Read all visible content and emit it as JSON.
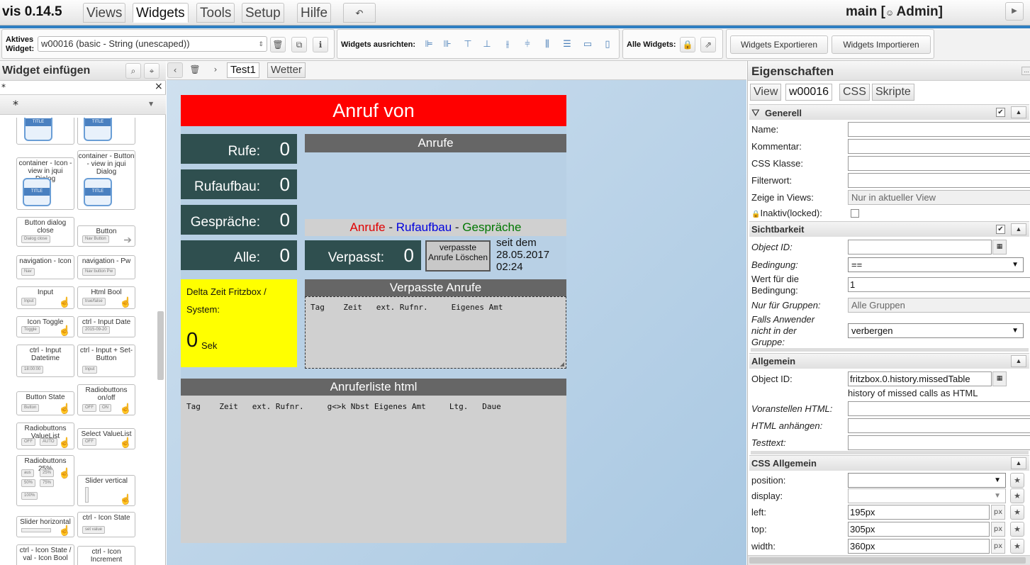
{
  "app": {
    "title": "vis 0.14.5",
    "user_label": "main [",
    "user_name": "Admin]"
  },
  "menu": {
    "items": [
      "Views",
      "Widgets",
      "Tools",
      "Setup",
      "Hilfe"
    ],
    "active": "Widgets"
  },
  "toolbar": {
    "active_widget_label_1": "Aktives",
    "active_widget_label_2": "Widget:",
    "active_widget_value": "w00016 (basic - String (unescaped))",
    "align_label": "Widgets ausrichten:",
    "all_widgets_label": "Alle Widgets:",
    "export_label": "Widgets Exportieren",
    "import_label": "Widgets Importieren"
  },
  "left": {
    "title": "Widget einfügen",
    "filter_value": "*",
    "filter_clear": "×",
    "set_value": "*",
    "palette": [
      "container - Icon - view in jqui Dialog",
      "container - Button - view in jqui Dialog",
      "Button dialog close",
      "Button",
      "navigation - Icon",
      "navigation - Pw",
      "Input",
      "Html Bool",
      "Icon Toggle",
      "ctrl - Input Date",
      "ctrl - Input Datetime",
      "ctrl - Input + Set-Button",
      "Button State",
      "Radiobuttons on/off",
      "Radiobuttons ValueList",
      "Select ValueList",
      "Radiobuttons 25%",
      "Slider vertical",
      "Slider horizontal",
      "ctrl - Icon State",
      "ctrl - Icon State / val - Icon Bool",
      "ctrl - Icon Increment"
    ],
    "minis": {
      "title": "TITLE",
      "dialog_close": "Dialog close",
      "nav_button": "Nav Button",
      "nav": "Nav",
      "nav_button_pw": "Nav button Pw",
      "input": "Input",
      "truefalse": "true/false",
      "toggle": "Toggle",
      "date": "2015-09-20",
      "datetime": "18:00:00",
      "input2": "Input",
      "button": "Button",
      "off": "OFF",
      "on": "ON",
      "auto": "AUTO",
      "aus": "aus",
      "p25": "25%",
      "p50": "50%",
      "p75": "75%",
      "p100": "100%",
      "set_value": "set value"
    }
  },
  "canvas": {
    "view_tabs": [
      "Test1",
      "Wetter"
    ],
    "active_view": "Test1",
    "header": "Anruf von",
    "stats": [
      {
        "label": "Rufe:",
        "value": "0"
      },
      {
        "label": "Rufaufbau:",
        "value": "0"
      },
      {
        "label": "Gespräche:",
        "value": "0"
      },
      {
        "label": "Alle:",
        "value": "0"
      }
    ],
    "anrufe_title": "Anrufe",
    "legend": {
      "a": "Anrufe",
      "sep1": " - ",
      "b": "Rufaufbau",
      "sep2": " - ",
      "c": "Gespräche"
    },
    "missed_label": "Verpasst:",
    "missed_value": "0",
    "clear_button": "verpasste Anrufe Löschen",
    "since_1": "seit dem",
    "since_2": "28.05.2017",
    "since_3": "02:24",
    "delta_title_1": "Delta Zeit Fritzbox /",
    "delta_title_2": "System:",
    "delta_value": "0",
    "delta_unit": "Sek",
    "missed_title": "Verpasste Anrufe",
    "missed_header": "Tag    Zeit   ext. Rufnr.     Eigenes Amt",
    "list_title": "Anruferliste html",
    "list_header": "Tag    Zeit   ext. Rufnr.     g<>k Nbst Eigenes Amt     Ltg.   Daue"
  },
  "colors": {
    "header_red": "#ff0000",
    "stat_bg": "#2f4f4f",
    "yellow": "#ffff00",
    "legend_a": "#e00000",
    "legend_b": "#0000dd",
    "legend_c": "#007700",
    "accent": "#2e7fc2"
  },
  "props": {
    "title": "Eigenschaften",
    "tabs": [
      "View",
      "w00016",
      "CSS",
      "Skripte"
    ],
    "active_tab": "w00016",
    "generell": {
      "title": "Generell",
      "name": "Name:",
      "kommentar": "Kommentar:",
      "css_klasse": "CSS Klasse:",
      "filterwort": "Filterwort:",
      "zeige": "Zeige in Views:",
      "zeige_value": "Nur in aktueller View",
      "inaktiv": "Inaktiv(locked):"
    },
    "sichtbarkeit": {
      "title": "Sichtbarkeit",
      "object_id": "Object ID:",
      "bedingung": "Bedingung:",
      "bedingung_value": "==",
      "wert_1": "Wert für die",
      "wert_2": "Bedingung:",
      "wert_value": "1",
      "gruppen": "Nur für Gruppen:",
      "gruppen_value": "Alle Gruppen",
      "falls_1": "Falls Anwender",
      "falls_2": "nicht in der",
      "falls_3": "Gruppe:",
      "falls_value": "verbergen"
    },
    "allgemein": {
      "title": "Allgemein",
      "object_id": "Object ID:",
      "object_id_value": "fritzbox.0.history.missedTable",
      "object_id_desc": "history of missed calls as HTML",
      "voranstellen": "Voranstellen HTML:",
      "anhaengen": "HTML anhängen:",
      "testtext": "Testtext:"
    },
    "css": {
      "title": "CSS Allgemein",
      "position": "position:",
      "display": "display:",
      "left": "left:",
      "left_value": "195px",
      "top": "top:",
      "top_value": "305px",
      "width": "width:",
      "width_value": "360px",
      "unit": "px"
    }
  }
}
